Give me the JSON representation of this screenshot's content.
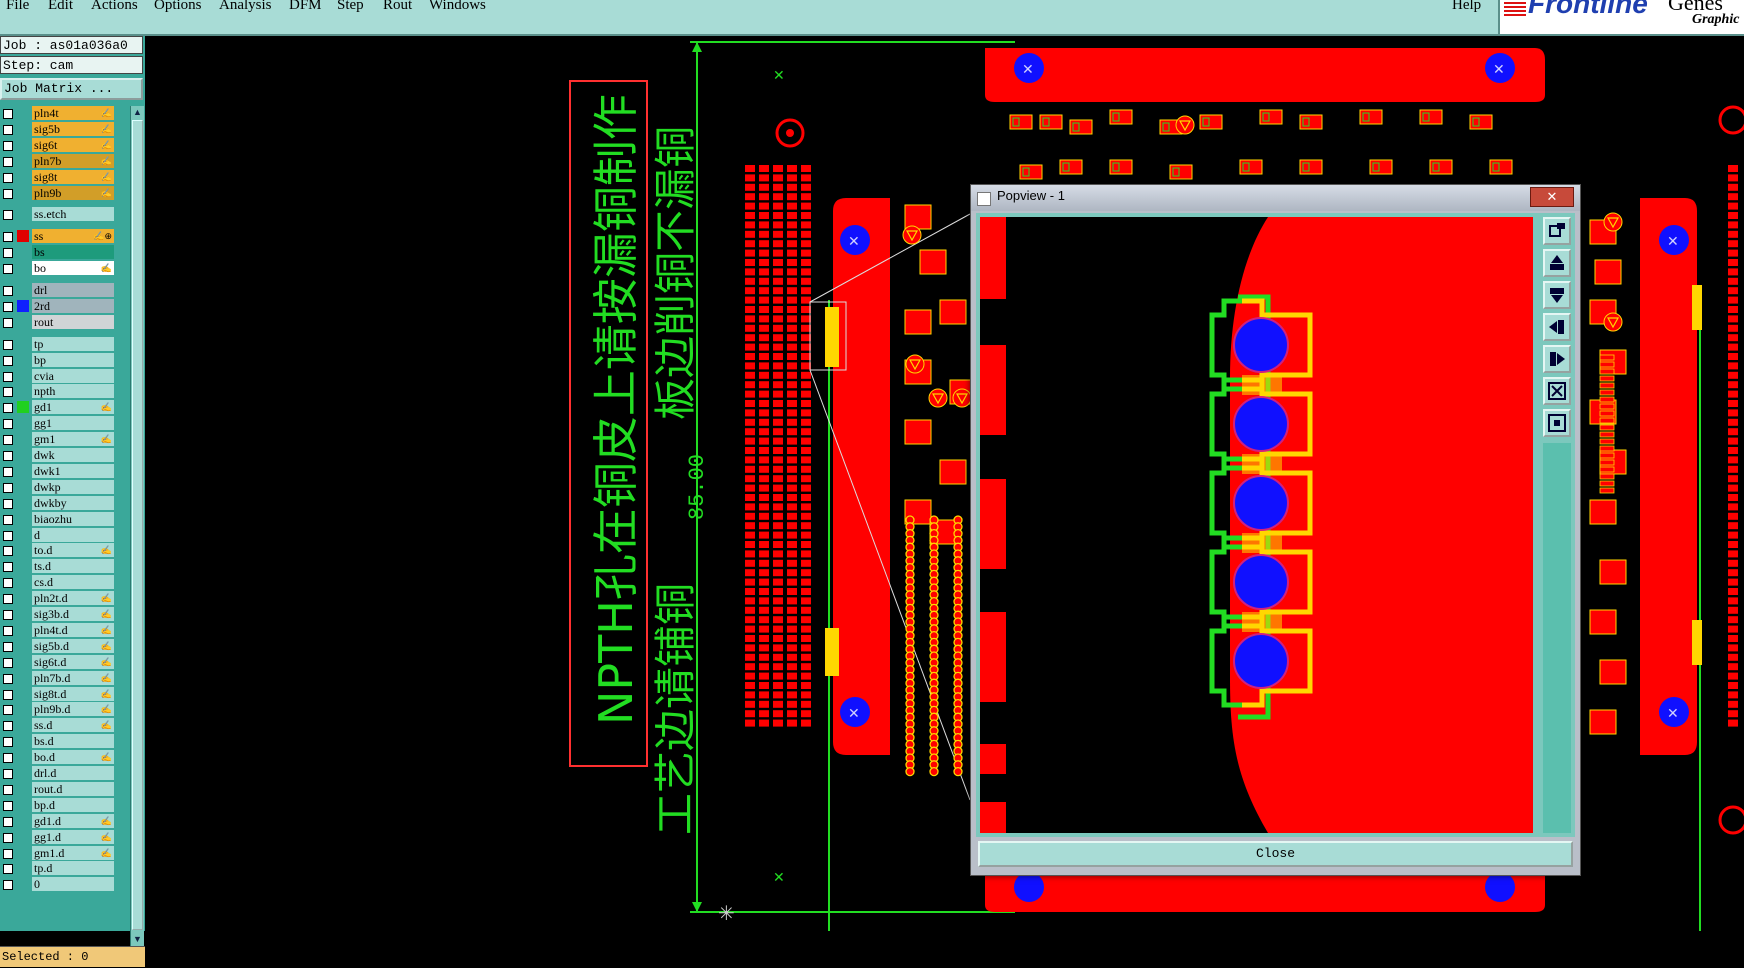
{
  "menu": {
    "items": [
      "File",
      "Edit",
      "Actions",
      "Options",
      "Analysis",
      "DFM",
      "Step",
      "Rout",
      "Windows"
    ],
    "help": "Help"
  },
  "brand": {
    "name": "Frontline",
    "extra": "Genes",
    "sub": "Graphic"
  },
  "sidebar": {
    "job_label": "Job : as01a036a0",
    "step_label": "Step: cam",
    "job_matrix_button": "Job Matrix ...",
    "layers": [
      {
        "name": "pln4t",
        "bg": "#f0b030",
        "flag": "✍",
        "color": ""
      },
      {
        "name": "sig5b",
        "bg": "#f0b030",
        "flag": "✍",
        "color": ""
      },
      {
        "name": "sig6t",
        "bg": "#f0b030",
        "flag": "✍",
        "color": ""
      },
      {
        "name": "pln7b",
        "bg": "#d29e28",
        "flag": "✍",
        "color": ""
      },
      {
        "name": "sig8t",
        "bg": "#f0b030",
        "flag": "✍",
        "color": ""
      },
      {
        "name": "pln9b",
        "bg": "#d29e28",
        "flag": "✍",
        "color": ""
      },
      {
        "name": "",
        "bg": "",
        "flag": "",
        "color": ""
      },
      {
        "name": "ss.etch",
        "bg": "#a8dcd6",
        "flag": "",
        "color": ""
      },
      {
        "name": "",
        "bg": "",
        "flag": "",
        "color": ""
      },
      {
        "name": "ss",
        "bg": "#f0b030",
        "flag": "✍⊕",
        "color": "#e00000"
      },
      {
        "name": "bs",
        "bg": "#1e9b7c",
        "flag": "",
        "color": ""
      },
      {
        "name": "bo",
        "bg": "#ffffff",
        "flag": "✍",
        "color": ""
      },
      {
        "name": "",
        "bg": "",
        "flag": "",
        "color": ""
      },
      {
        "name": "drl",
        "bg": "#a0b4bc",
        "flag": "",
        "color": ""
      },
      {
        "name": "2rd",
        "bg": "#a0b4bc",
        "flag": "",
        "color": "#1020ff"
      },
      {
        "name": "rout",
        "bg": "#d0d4d6",
        "flag": "",
        "color": ""
      },
      {
        "name": "",
        "bg": "",
        "flag": "",
        "color": ""
      },
      {
        "name": "tp",
        "bg": "#a8dcd6",
        "flag": "",
        "color": ""
      },
      {
        "name": "bp",
        "bg": "#a8dcd6",
        "flag": "",
        "color": ""
      },
      {
        "name": "cvia",
        "bg": "#a8dcd6",
        "flag": "",
        "color": ""
      },
      {
        "name": "npth",
        "bg": "#a8dcd6",
        "flag": "",
        "color": ""
      },
      {
        "name": "gd1",
        "bg": "#a8dcd6",
        "flag": "✍",
        "color": "#20d020"
      },
      {
        "name": "gg1",
        "bg": "#a8dcd6",
        "flag": "",
        "color": ""
      },
      {
        "name": "gm1",
        "bg": "#a8dcd6",
        "flag": "✍",
        "color": ""
      },
      {
        "name": "dwk",
        "bg": "#a8dcd6",
        "flag": "",
        "color": ""
      },
      {
        "name": "dwk1",
        "bg": "#a8dcd6",
        "flag": "",
        "color": ""
      },
      {
        "name": "dwkp",
        "bg": "#a8dcd6",
        "flag": "",
        "color": ""
      },
      {
        "name": "dwkby",
        "bg": "#a8dcd6",
        "flag": "",
        "color": ""
      },
      {
        "name": "biaozhu",
        "bg": "#a8dcd6",
        "flag": "",
        "color": ""
      },
      {
        "name": "d",
        "bg": "#a8dcd6",
        "flag": "",
        "color": ""
      },
      {
        "name": "to.d",
        "bg": "#a8dcd6",
        "flag": "✍",
        "color": ""
      },
      {
        "name": "ts.d",
        "bg": "#a8dcd6",
        "flag": "",
        "color": ""
      },
      {
        "name": "cs.d",
        "bg": "#a8dcd6",
        "flag": "",
        "color": ""
      },
      {
        "name": "pln2t.d",
        "bg": "#a8dcd6",
        "flag": "✍",
        "color": ""
      },
      {
        "name": "sig3b.d",
        "bg": "#a8dcd6",
        "flag": "✍",
        "color": ""
      },
      {
        "name": "pln4t.d",
        "bg": "#a8dcd6",
        "flag": "✍",
        "color": ""
      },
      {
        "name": "sig5b.d",
        "bg": "#a8dcd6",
        "flag": "✍",
        "color": ""
      },
      {
        "name": "sig6t.d",
        "bg": "#a8dcd6",
        "flag": "✍",
        "color": ""
      },
      {
        "name": "pln7b.d",
        "bg": "#a8dcd6",
        "flag": "✍",
        "color": ""
      },
      {
        "name": "sig8t.d",
        "bg": "#a8dcd6",
        "flag": "✍",
        "color": ""
      },
      {
        "name": "pln9b.d",
        "bg": "#a8dcd6",
        "flag": "✍",
        "color": ""
      },
      {
        "name": "ss.d",
        "bg": "#a8dcd6",
        "flag": "✍",
        "color": ""
      },
      {
        "name": "bs.d",
        "bg": "#a8dcd6",
        "flag": "",
        "color": ""
      },
      {
        "name": "bo.d",
        "bg": "#a8dcd6",
        "flag": "✍",
        "color": ""
      },
      {
        "name": "drl.d",
        "bg": "#a8dcd6",
        "flag": "",
        "color": ""
      },
      {
        "name": "rout.d",
        "bg": "#a8dcd6",
        "flag": "",
        "color": ""
      },
      {
        "name": "bp.d",
        "bg": "#a8dcd6",
        "flag": "",
        "color": ""
      },
      {
        "name": "gd1.d",
        "bg": "#a8dcd6",
        "flag": "✍",
        "color": ""
      },
      {
        "name": "gg1.d",
        "bg": "#a8dcd6",
        "flag": "✍",
        "color": ""
      },
      {
        "name": "gm1.d",
        "bg": "#a8dcd6",
        "flag": "✍",
        "color": ""
      },
      {
        "name": "tp.d",
        "bg": "#a8dcd6",
        "flag": "",
        "color": ""
      },
      {
        "name": "0",
        "bg": "#a8dcd6",
        "flag": "",
        "color": ""
      }
    ],
    "selected_label": "Selected : 0"
  },
  "canvas": {
    "annotation_line1": "NPTH孔在铜皮上请按漏铜制作",
    "annotation_line2": "板边削铜不漏铜",
    "annotation_line3": "工艺边请铺铜",
    "dimension": "85.00",
    "colors": {
      "copper": "#ff0000",
      "pad_yellow": "#ffd700",
      "outline_green": "#22dd22",
      "hole_blue": "#1010ff"
    }
  },
  "popview": {
    "title": "Popview - 1",
    "close_x": "✕",
    "close_button": "Close",
    "tools": [
      "zoom-window-icon",
      "pan-up-icon",
      "pan-down-icon",
      "pan-left-icon",
      "pan-right-icon",
      "zoom-fit-icon",
      "zoom-home-icon"
    ]
  }
}
